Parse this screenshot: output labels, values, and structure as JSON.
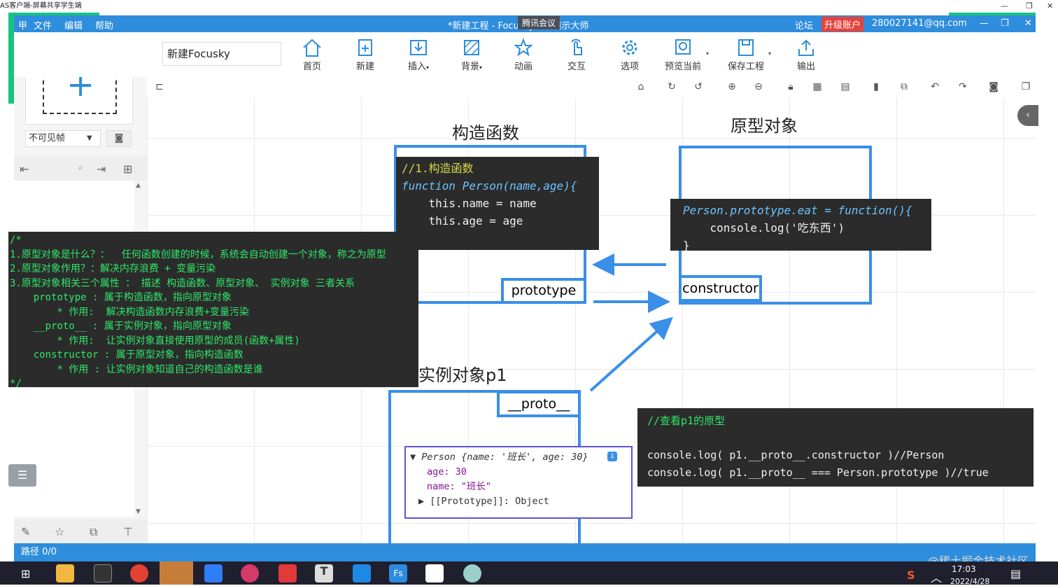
{
  "os_window": {
    "title": "AS客户端-屏幕共享学生端"
  },
  "app": {
    "logo_glyph": "甲",
    "menu": [
      "文件",
      "编辑",
      "帮助"
    ],
    "title": "*新建工程 - Focusky动画演示大师",
    "meeting_overlay": "腾讯会议",
    "forum": "论坛",
    "upgrade": "升级账户",
    "account": "280027141@qq.com"
  },
  "toolbar": {
    "project_name": "新建Focusky",
    "buttons": [
      "首页",
      "新建",
      "插入",
      "背景",
      "动画",
      "交互",
      "选项",
      "预览当前",
      "保存工程",
      "输出"
    ]
  },
  "sidebar": {
    "frame_select": "不可见帧",
    "list_icon": "list-icon"
  },
  "slide": {
    "constructor_title": "构造函数",
    "prototype_title": "原型对象",
    "instance_title": "实例对象p1",
    "prototype_tag": "prototype",
    "constructor_tag": "constructor",
    "proto_tag": "__proto__",
    "code_constructor": [
      "//1.构造函数",
      "function Person(name,age){",
      "    this.name = name",
      "    this.age = age"
    ],
    "code_proto": [
      "Person.prototype.eat = function(){",
      "    console.log('吃东西')",
      "}"
    ],
    "code_check": [
      "//查看p1的原型",
      "console.log( p1.__proto__.constructor )//Person",
      "console.log( p1.__proto__ === Person.prototype )//true"
    ],
    "notes": [
      "/*",
      "1.原型对象是什么？：  任何函数创建的时候，系统会自动创建一个对象，称之为原型",
      "2.原型对象作用？：解决内存浪费 + 变量污染",
      "3.原型对象相关三个属性 ： 描述 构造函数、原型对象、 实例对象 三者关系",
      "    prototype : 属于构造函数，指向原型对象",
      "        * 作用:  解决构造函数内存浪费+变量污染",
      "    __proto__ : 属于实例对象，指向原型对象",
      "        * 作用:  让实例对象直接使用原型的成员(函数+属性)",
      "    constructor : 属于原型对象，指向构造函数",
      "        * 作用 : 让实例对象知道自己的构造函数是谁",
      "*/"
    ],
    "console": {
      "header": "▼ Person {name: '班长', age: 30}",
      "age_line": "age: 30",
      "name_line": "name: \"班长\"",
      "proto_line": "▶ [[Prototype]]: Object"
    }
  },
  "status": {
    "path": "路径 0/0",
    "watermark": "@稀土掘金技术社区"
  },
  "taskbar": {
    "time": "17:03",
    "date": "2022/4/28"
  },
  "colors": {
    "titlebar": "#2e8ddc",
    "accent_blue": "#3a8fe8",
    "green": "#19c37d",
    "comment": "#d8d84a"
  }
}
